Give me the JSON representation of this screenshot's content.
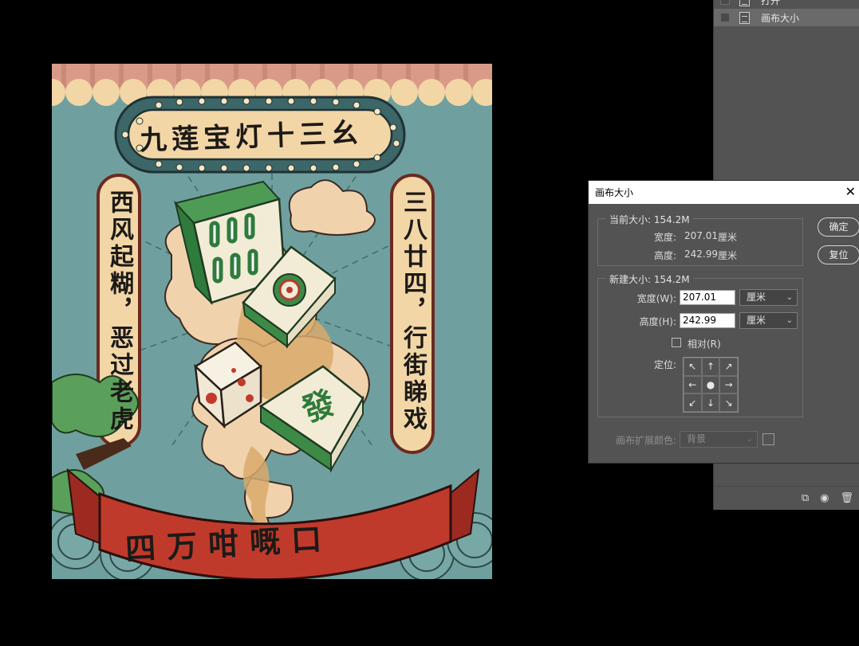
{
  "history": {
    "items": [
      {
        "label": "打开",
        "selected": false
      },
      {
        "label": "画布大小",
        "selected": true
      }
    ]
  },
  "artwork": {
    "title_banner": "九莲宝灯十三幺",
    "left_scroll": "西风起糊，恶过老虎",
    "right_scroll": "三八廿四，行街睇戏",
    "bottom_ribbon": "四万咁嘅口"
  },
  "dialog": {
    "title": "画布大小",
    "close_glyph": "✕",
    "current_size": {
      "title": "当前大小: 154.2M",
      "width_label": "宽度:",
      "width_value": "207.01",
      "width_unit": "厘米",
      "height_label": "高度:",
      "height_value": "242.99",
      "height_unit": "厘米"
    },
    "new_size": {
      "title": "新建大小: 154.2M",
      "width_label": "宽度(W):",
      "width_value": "207.01",
      "width_unit": "厘米",
      "height_label": "高度(H):",
      "height_value": "242.99",
      "height_unit": "厘米",
      "relative_label": "相对(R)",
      "relative_checked": false,
      "anchor_label": "定位:"
    },
    "ok_label": "确定",
    "reset_label": "复位",
    "extension_color_label": "画布扩展颜色:",
    "extension_color_value": "背景"
  },
  "icons": {
    "anchor_arrows": [
      "↖",
      "↑",
      "↗",
      "←",
      "●",
      "→",
      "↙",
      "↓",
      "↘"
    ],
    "footer": [
      "new-snapshot-icon",
      "camera-icon",
      "trash-icon"
    ]
  }
}
